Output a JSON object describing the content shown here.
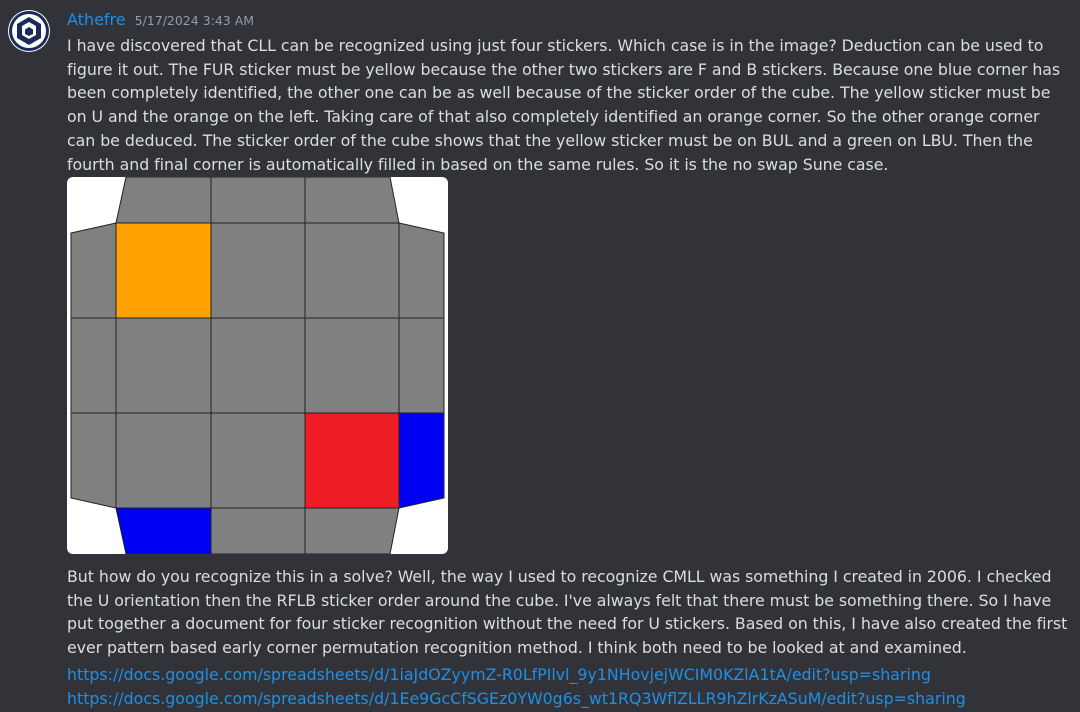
{
  "message": {
    "username": "Athefre",
    "timestamp": "5/17/2024 3:43 AM",
    "paragraph1": "I have discovered that CLL can be recognized using just four stickers. Which case is in the image? Deduction can be used to figure it out. The FUR sticker must be yellow because the other two stickers are F and B stickers. Because one blue corner has been completely identified, the other one can be as well because of the sticker order of the cube. The yellow sticker must be on U and the orange on the left. Taking care of that also completely identified an orange corner. So the other orange corner can be deduced. The sticker order of the cube shows that the yellow sticker must be on BUL and a green on LBU. Then the fourth and final corner is automatically filled in based on the same rules. So it is the no swap Sune case.",
    "paragraph2": "But how do you recognize this in a solve? Well, the way I used to recognize CMLL was something I created in 2006. I checked the U orientation then the RFLB sticker order around the cube. I've always felt that there must be something there. So I have put together a document for four sticker recognition without the need for U stickers. Based on this, I have also created the first ever pattern based early corner permutation recognition method. I think both need to be looked at and examined.",
    "links": [
      "https://docs.google.com/spreadsheets/d/1iaJdOZyymZ-R0LfPIlvl_9y1NHovjejWCIM0KZlA1tA/edit?usp=sharing",
      "https://docs.google.com/spreadsheets/d/1Ee9GcCfSGEz0YW0g6s_wt1RQ3WflZLLR9hZlrKzASuM/edit?usp=sharing"
    ]
  },
  "avatar_icon": "cube-logo-icon",
  "colors": {
    "background": "#313338",
    "text": "#dbdee1",
    "username": "#1e90e6",
    "link": "#1e90e6",
    "timestamp": "#949ba4",
    "sticker_gray": "#808080",
    "sticker_orange": "#ffa100",
    "sticker_red": "#ee1c24",
    "sticker_blue": "#0000f2"
  },
  "cube_image": {
    "description_stickers": {
      "top_row_left_face": "gray",
      "u_face_grid": [
        [
          "orange",
          "gray",
          "gray"
        ],
        [
          "gray",
          "gray",
          "gray"
        ],
        [
          "gray",
          "gray",
          "red"
        ]
      ],
      "right_side_bottom": "blue",
      "front_side_left": "blue"
    }
  }
}
